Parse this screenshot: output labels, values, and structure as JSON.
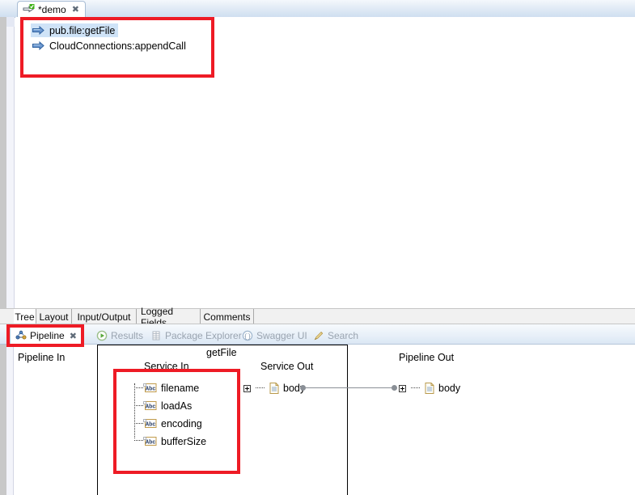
{
  "editor": {
    "tab": {
      "label": "*demo",
      "close": "✖",
      "icon": "flow-service-icon"
    },
    "steps": [
      {
        "label": "pub.file:getFile",
        "icon": "invoke-arrow-icon",
        "selected": true
      },
      {
        "label": "CloudConnections:appendCall",
        "icon": "invoke-arrow-icon",
        "selected": false
      }
    ]
  },
  "view_tabs": [
    {
      "label": "Tree",
      "active": true
    },
    {
      "label": "Layout",
      "active": false
    },
    {
      "label": "Input/Output",
      "active": false
    },
    {
      "label": "Logged Fields",
      "active": false
    },
    {
      "label": "Comments",
      "active": false
    }
  ],
  "bottom_tabs": [
    {
      "label": "Pipeline",
      "icon": "pipeline-icon",
      "active": true,
      "close": "✖"
    },
    {
      "label": "Results",
      "icon": "results-play-icon",
      "active": false
    },
    {
      "label": "Package Explorer",
      "icon": "package-explorer-icon",
      "active": false
    },
    {
      "label": "Swagger UI",
      "icon": "swagger-braces-icon",
      "active": false
    },
    {
      "label": "Search",
      "icon": "search-pencil-icon",
      "active": false
    }
  ],
  "pipeline": {
    "service_name": "getFile",
    "columns": {
      "pipeline_in": "Pipeline In",
      "service_in": "Service In",
      "service_out": "Service Out",
      "pipeline_out": "Pipeline Out"
    },
    "service_in_fields": [
      {
        "name": "filename",
        "type": "string",
        "icon": "abc-string-icon"
      },
      {
        "name": "loadAs",
        "type": "string",
        "icon": "abc-string-icon"
      },
      {
        "name": "encoding",
        "type": "string",
        "icon": "abc-string-icon"
      },
      {
        "name": "bufferSize",
        "type": "string",
        "icon": "abc-string-icon"
      }
    ],
    "service_out_fields": [
      {
        "name": "body",
        "type": "document",
        "icon": "document-icon",
        "expander": "+"
      }
    ],
    "pipeline_out_fields": [
      {
        "name": "body",
        "type": "document",
        "icon": "document-icon",
        "expander": "+"
      }
    ],
    "links": [
      {
        "from": "Service Out.body",
        "to": "Pipeline Out.body"
      }
    ]
  },
  "annotations": {
    "color": "#ee1b25",
    "boxes": [
      {
        "name": "flow-steps-highlight"
      },
      {
        "name": "pipeline-tab-highlight"
      },
      {
        "name": "service-in-fields-highlight"
      }
    ]
  }
}
